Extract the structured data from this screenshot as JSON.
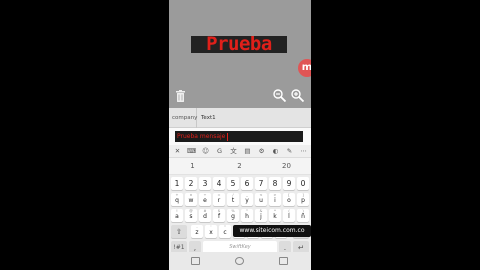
{
  "preview": {
    "led_text": "Prueba",
    "badge": "m"
  },
  "tabs": [
    {
      "label": "company"
    },
    {
      "label": "Text1"
    }
  ],
  "input": {
    "value": "Prueba mensaje"
  },
  "toolbar": {
    "icons": [
      "close-icon",
      "keyboard-icon",
      "emoji-icon",
      "gif-icon",
      "translate-icon",
      "clipboard-icon",
      "settings-icon",
      "palette-icon",
      "mic-icon",
      "more-icon"
    ],
    "glyphs": [
      "✕",
      "⌨",
      "☺",
      "G",
      "文",
      "▤",
      "⚙",
      "◐",
      "✎",
      "⋯"
    ]
  },
  "suggestions": [
    "1",
    "2",
    "20"
  ],
  "keyboard": {
    "numbers": [
      "1",
      "2",
      "3",
      "4",
      "5",
      "6",
      "7",
      "8",
      "9",
      "0"
    ],
    "row1": [
      "q",
      "w",
      "e",
      "r",
      "t",
      "y",
      "u",
      "i",
      "o",
      "p"
    ],
    "row1_hints": [
      "+",
      "×",
      "÷",
      "=",
      "/",
      "_",
      "<",
      ">",
      "[",
      "]"
    ],
    "row2": [
      "a",
      "s",
      "d",
      "f",
      "g",
      "h",
      "j",
      "k",
      "l",
      "ñ"
    ],
    "row2_hints": [
      "!",
      "@",
      "#",
      "$",
      "%",
      "^",
      "&",
      "*",
      "(",
      ")"
    ],
    "row3": [
      "z",
      "x",
      "c",
      "v",
      "b",
      "n",
      "m"
    ],
    "row3_hints": [
      "-",
      "'",
      "\"",
      ":",
      ";",
      ",",
      "?"
    ],
    "shift": "⇧",
    "backspace": "⌫",
    "symbols_key": "!#1",
    "comma": ",",
    "space": "SwiftKey",
    "period": ".",
    "enter": "↵"
  },
  "watermark": "www.siteicom.com.co"
}
